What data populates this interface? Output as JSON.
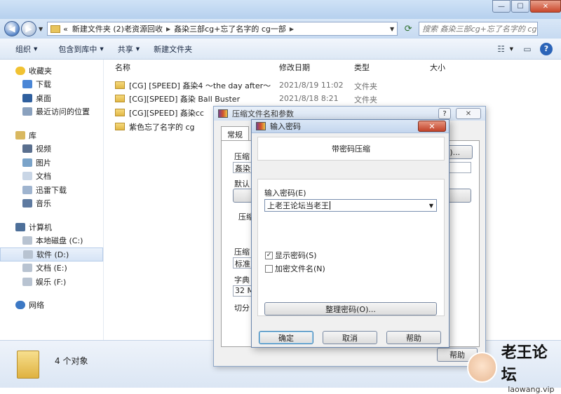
{
  "window": {
    "buttons": {
      "minimize": "—",
      "maximize": "☐",
      "close": "✕"
    }
  },
  "address": {
    "crumbs": [
      "新建文件夹 (2)老资源回收",
      "姦染三部cg+忘了名字的 cg一部"
    ],
    "prefix": "«",
    "search_placeholder": "搜索 姦染三部cg+忘了名字的 cg一部"
  },
  "toolbar": {
    "organize": "组织",
    "include_library": "包含到库中",
    "share": "共享",
    "new_folder": "新建文件夹"
  },
  "sidebar": {
    "favorites": "收藏夹",
    "fav_items": [
      "下载",
      "桌面",
      "最近访问的位置"
    ],
    "libraries": "库",
    "lib_items": [
      "视频",
      "图片",
      "文档",
      "迅雷下载",
      "音乐"
    ],
    "computer": "计算机",
    "drives": [
      "本地磁盘 (C:)",
      "软件 (D:)",
      "文档 (E:)",
      "娱乐 (F:)"
    ],
    "network": "网络"
  },
  "columns": {
    "name": "名称",
    "date": "修改日期",
    "type": "类型",
    "size": "大小"
  },
  "files": [
    {
      "name": "[CG] [SPEED] 姦染4 ～the day after～",
      "date": "2021/8/19 11:02",
      "type": "文件夹"
    },
    {
      "name": "[CG][SPEED] 姦染 Ball Buster",
      "date": "2021/8/18 8:21",
      "type": "文件夹"
    },
    {
      "name": "[CG][SPEED] 姦染cc",
      "date": "",
      "type": ""
    },
    {
      "name": "紫色忘了名字的 cg",
      "date": "",
      "type": ""
    }
  ],
  "status": {
    "count": "4 个对象"
  },
  "zip_dialog": {
    "title": "压缩文件名和参数",
    "tab_general": "常规",
    "label_archive": "压缩",
    "field_archive": "姦染",
    "label_default": "默认",
    "label_format": "压缩",
    "label_method": "压缩",
    "field_method": "标准",
    "label_dict": "字典",
    "field_dict": "32 M",
    "label_split": "切分",
    "btn_browse": "B)...",
    "btn_help": "帮助",
    "help_btn": "?",
    "close_btn": "✕"
  },
  "pw_dialog": {
    "title": "输入密码",
    "close": "✕",
    "banner": "带密码压缩",
    "label": "输入密码(E)",
    "value": "上老王论坛当老王",
    "show_password": "显示密码(S)",
    "encrypt_names": "加密文件名(N)",
    "manage": "整理密码(O)...",
    "ok": "确定",
    "cancel": "取消",
    "help": "帮助"
  },
  "watermark": {
    "name": "老王论坛",
    "url": "laowang.vip"
  }
}
